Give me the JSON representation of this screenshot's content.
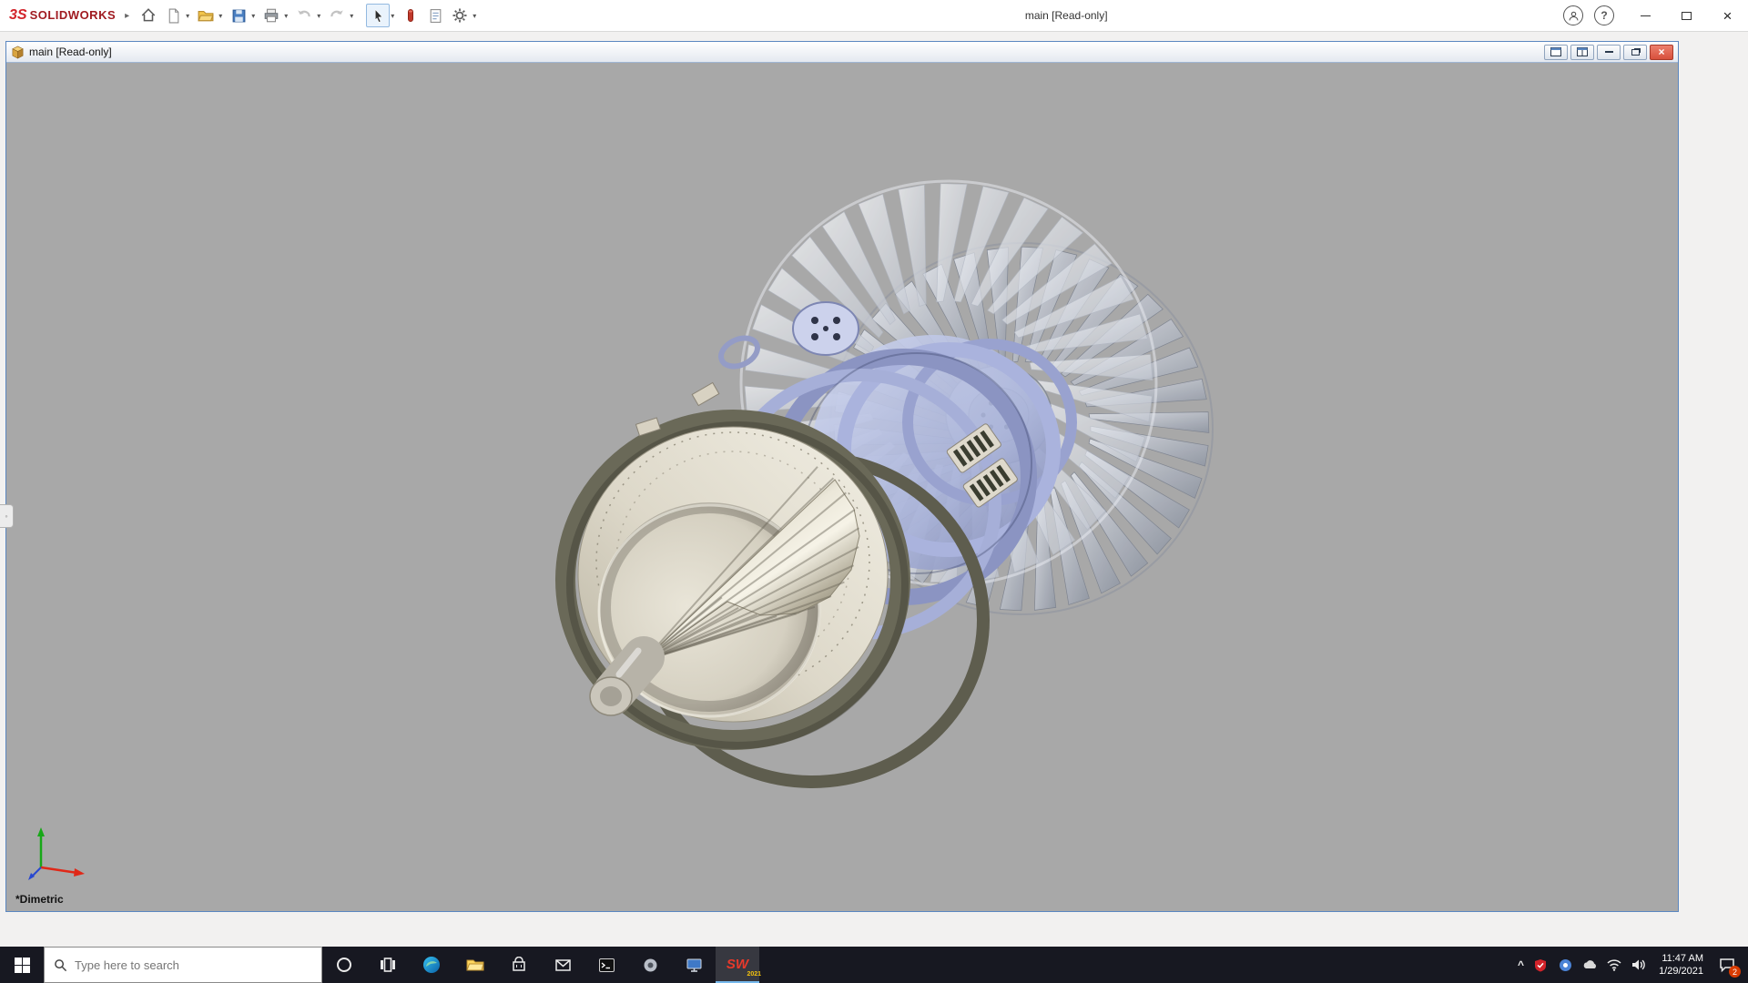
{
  "app": {
    "brand_mark": "3S",
    "brand_name": "SOLIDWORKS",
    "title": "main [Read-only]",
    "expander_glyph": "▸",
    "dropdown_glyph": "▾",
    "help_glyph": "?",
    "close_glyph": "×"
  },
  "toolbar_buttons": [
    "home",
    "new-document",
    "open",
    "save",
    "print",
    "undo",
    "redo",
    "select",
    "instant3d",
    "design-report",
    "options"
  ],
  "document": {
    "title": "main [Read-only]",
    "view_orientation": "*Dimetric",
    "close_glyph": "×"
  },
  "viewport": {
    "background": "#a8a8a8",
    "model": "jet-engine-turbine-assembly"
  },
  "taskbar": {
    "search_placeholder": "Type here to search",
    "apps": [
      "edge",
      "file-explorer",
      "store",
      "mail",
      "terminal",
      "settings-gear",
      "display",
      "solidworks-2021"
    ],
    "sw_logo": "SW",
    "sw_year": "2021",
    "tray_expand_glyph": "^",
    "time": "11:47 AM",
    "date": "1/29/2021",
    "notification_badge": "2"
  },
  "flyout_tab_glyph": "◦",
  "colors": {
    "accent_red": "#d2232a",
    "taskbar_bg": "#171821",
    "doc_border_blue": "#5b87c0",
    "engine_periwinkle": "#aab3dd",
    "engine_ivory": "#ddd8c9"
  }
}
